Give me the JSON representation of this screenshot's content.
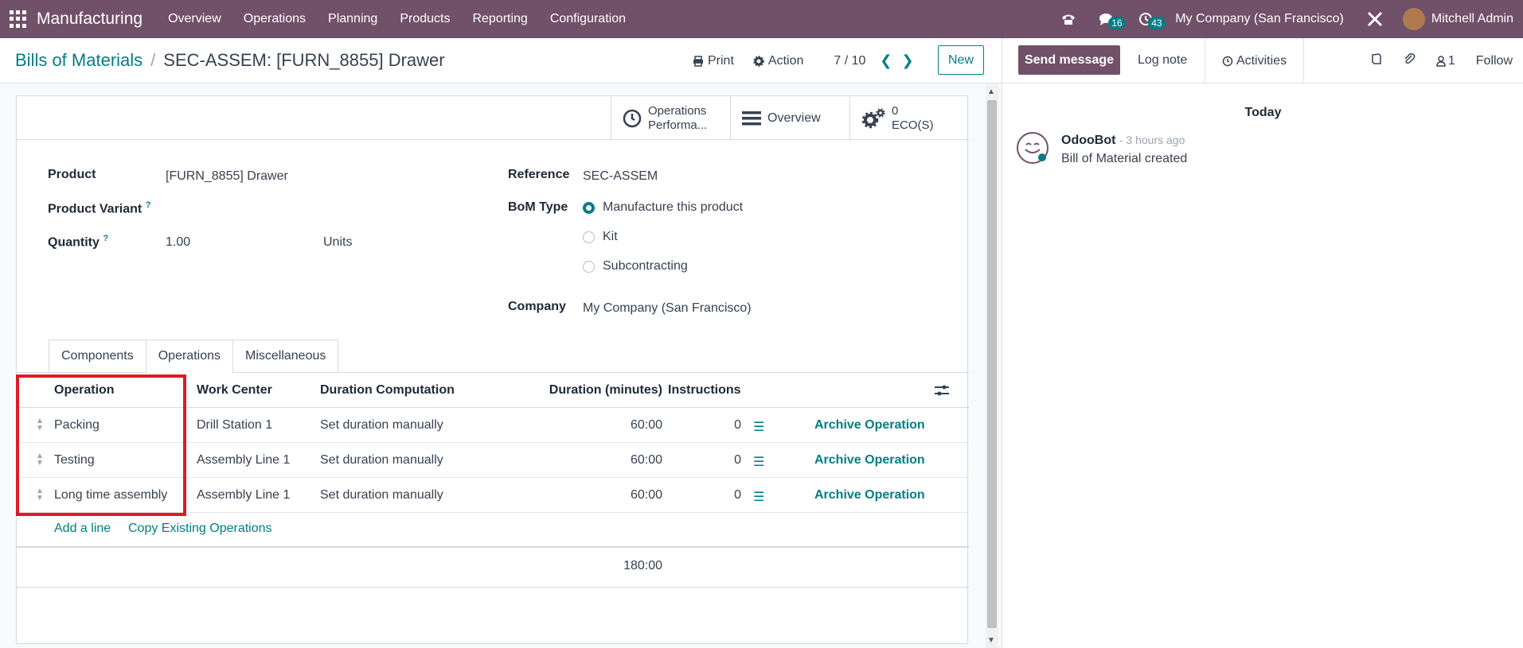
{
  "navbar": {
    "app_name": "Manufacturing",
    "menu": [
      "Overview",
      "Operations",
      "Planning",
      "Products",
      "Reporting",
      "Configuration"
    ],
    "messages_count": "16",
    "activities_count": "43",
    "company": "My Company (San Francisco)",
    "user": "Mitchell Admin"
  },
  "control": {
    "breadcrumb_parent": "Bills of Materials",
    "breadcrumb_separator": "/",
    "breadcrumb_current": "SEC-ASSEM: [FURN_8855] Drawer",
    "print_label": "Print",
    "action_label": "Action",
    "pager": "7 / 10",
    "new_label": "New"
  },
  "smart_buttons": {
    "operations_line1": "Operations",
    "operations_line2": "Performa...",
    "overview": "Overview",
    "eco_count": "0",
    "eco_label": "ECO(S)"
  },
  "form": {
    "product_label": "Product",
    "product_value": "[FURN_8855] Drawer",
    "variant_label": "Product Variant",
    "quantity_label": "Quantity",
    "quantity_value": "1.00",
    "uom_value": "Units",
    "reference_label": "Reference",
    "reference_value": "SEC-ASSEM",
    "bom_type_label": "BoM Type",
    "bom_type_options": [
      "Manufacture this product",
      "Kit",
      "Subcontracting"
    ],
    "bom_type_selected": "Manufacture this product",
    "company_label": "Company",
    "company_value": "My Company (San Francisco)",
    "help_mark": "?"
  },
  "tabs": [
    "Components",
    "Operations",
    "Miscellaneous"
  ],
  "active_tab": "Operations",
  "operations_table": {
    "columns": [
      "Operation",
      "Work Center",
      "Duration Computation",
      "Duration (minutes)",
      "Instructions"
    ],
    "rows": [
      {
        "operation": "Packing",
        "work_center": "Drill Station 1",
        "computation": "Set duration manually",
        "duration": "60:00",
        "instructions": "0",
        "action": "Archive Operation"
      },
      {
        "operation": "Testing",
        "work_center": "Assembly Line 1",
        "computation": "Set duration manually",
        "duration": "60:00",
        "instructions": "0",
        "action": "Archive Operation"
      },
      {
        "operation": "Long time assembly",
        "work_center": "Assembly Line 1",
        "computation": "Set duration manually",
        "duration": "60:00",
        "instructions": "0",
        "action": "Archive Operation"
      }
    ],
    "add_line": "Add a line",
    "copy_existing": "Copy Existing Operations",
    "total_duration": "180:00"
  },
  "chatter": {
    "send_message": "Send message",
    "log_note": "Log note",
    "activities": "Activities",
    "followers_count": "1",
    "follow": "Follow",
    "date_separator": "Today",
    "message_author": "OdooBot",
    "message_time": "- 3 hours ago",
    "message_body": "Bill of Material created"
  },
  "colors": {
    "brand": "#71506a",
    "accent": "#017e84",
    "highlight": "#e01b24"
  }
}
